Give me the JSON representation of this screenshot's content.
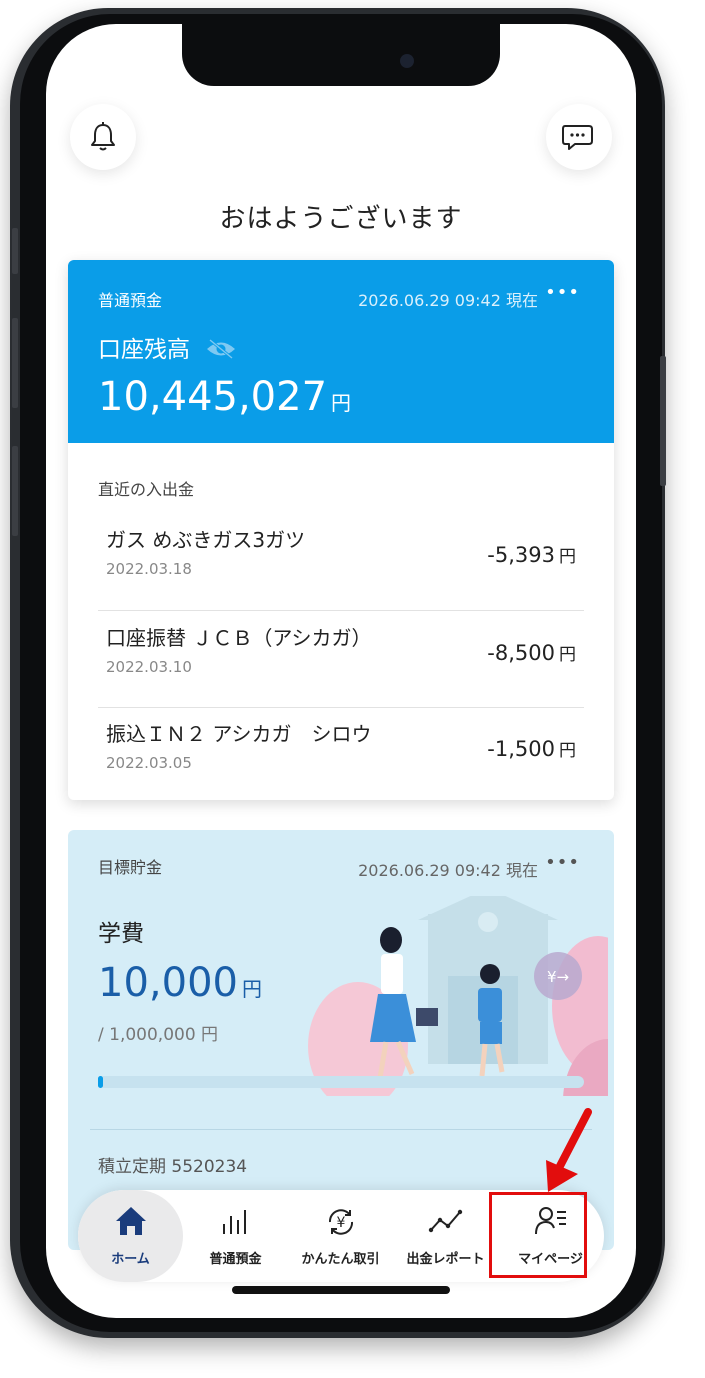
{
  "greeting": "おはようございます",
  "savings_card": {
    "label": "普通預金",
    "timestamp": "2026.06.29 09:42 現在",
    "menu": "•••",
    "balance_label": "口座残高",
    "balance": "10,445,027",
    "currency": "円",
    "recent_title": "直近の入出金",
    "transactions": [
      {
        "name": "ガス めぶきガス3ガツ",
        "date": "2022.03.18",
        "amount": "-5,393",
        "currency": "円"
      },
      {
        "name": "口座振替 ＪＣＢ（アシカガ）",
        "date": "2022.03.10",
        "amount": "-8,500",
        "currency": "円"
      },
      {
        "name": "振込ＩＮ２ アシカガ　シロウ",
        "date": "2022.03.05",
        "amount": "-1,500",
        "currency": "円"
      }
    ]
  },
  "goal_card": {
    "label": "目標貯金",
    "timestamp": "2026.06.29 09:42 現在",
    "menu": "•••",
    "goal_name": "学費",
    "amount": "10,000",
    "currency": "円",
    "target": "/ 1,000,000 円",
    "progress_fraction": 0.01,
    "account": "積立定期 5520234"
  },
  "tabs": [
    {
      "label": "ホーム",
      "icon": "home-icon",
      "active": true
    },
    {
      "label": "普通預金",
      "icon": "bar-chart-icon",
      "active": false
    },
    {
      "label": "かんたん取引",
      "icon": "yen-exchange-icon",
      "active": false
    },
    {
      "label": "出金レポート",
      "icon": "line-chart-icon",
      "active": false
    },
    {
      "label": "マイページ",
      "icon": "user-list-icon",
      "active": false
    }
  ],
  "colors": {
    "primary": "#0a9de8",
    "goal_bg": "#d5edf7",
    "accent_dark": "#1a3c7c",
    "annotation": "#e20d0d"
  }
}
